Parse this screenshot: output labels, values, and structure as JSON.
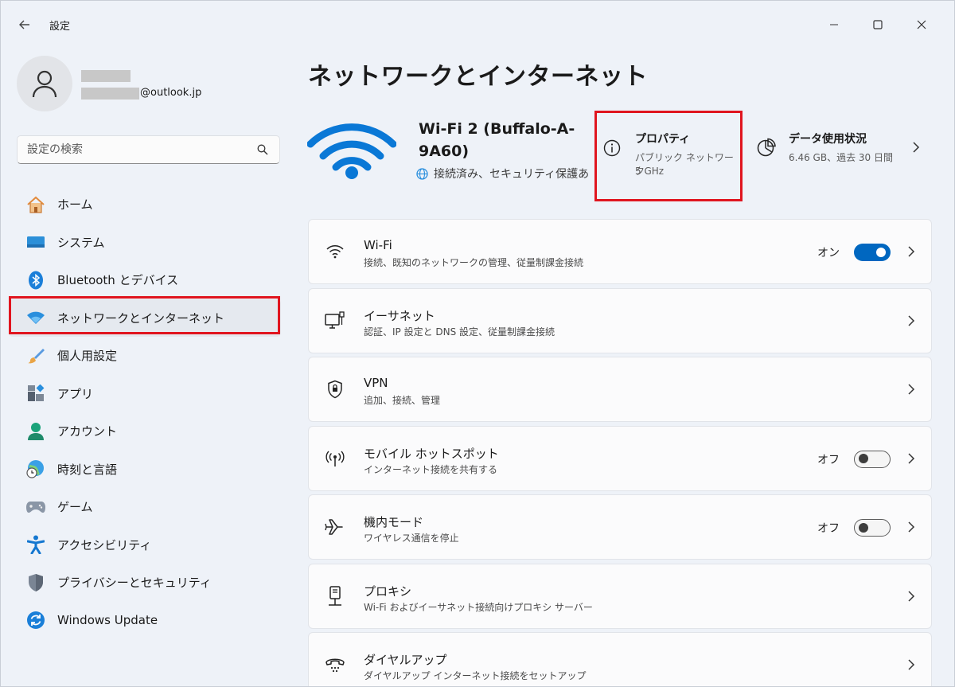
{
  "window": {
    "title": "設定"
  },
  "profile": {
    "email_suffix": "@outlook.jp"
  },
  "search": {
    "placeholder": "設定の検索"
  },
  "sidebar": {
    "items": [
      {
        "label": "ホーム",
        "icon": "home-icon"
      },
      {
        "label": "システム",
        "icon": "system-icon"
      },
      {
        "label": "Bluetooth とデバイス",
        "icon": "bluetooth-icon"
      },
      {
        "label": "ネットワークとインターネット",
        "icon": "wifi-icon",
        "active": true
      },
      {
        "label": "個人用設定",
        "icon": "brush-icon"
      },
      {
        "label": "アプリ",
        "icon": "apps-icon"
      },
      {
        "label": "アカウント",
        "icon": "account-icon"
      },
      {
        "label": "時刻と言語",
        "icon": "clock-globe-icon"
      },
      {
        "label": "ゲーム",
        "icon": "gamepad-icon"
      },
      {
        "label": "アクセシビリティ",
        "icon": "accessibility-icon"
      },
      {
        "label": "プライバシーとセキュリティ",
        "icon": "shield-icon"
      },
      {
        "label": "Windows Update",
        "icon": "update-icon"
      }
    ]
  },
  "main": {
    "title": "ネットワークとインターネット",
    "network": {
      "ssid": "Wi-Fi 2 (Buffalo-A-9A60)",
      "status": "接続済み、セキュリティ保護あ"
    },
    "properties": {
      "title": "プロパティ",
      "line1": "パブリック ネットワーク",
      "line2": "5 GHz"
    },
    "usage": {
      "title": "データ使用状況",
      "sub": "6.46 GB、過去 30 日間"
    },
    "rows": [
      {
        "title": "Wi-Fi",
        "sub": "接続、既知のネットワークの管理、従量制課金接続",
        "state": "オン",
        "toggle": "on",
        "icon": "wifi-icon"
      },
      {
        "title": "イーサネット",
        "sub": "認証、IP 設定と DNS 設定、従量制課金接続",
        "icon": "ethernet-icon"
      },
      {
        "title": "VPN",
        "sub": "追加、接続、管理",
        "icon": "vpn-shield-icon"
      },
      {
        "title": "モバイル ホットスポット",
        "sub": "インターネット接続を共有する",
        "state": "オフ",
        "toggle": "off",
        "icon": "hotspot-icon"
      },
      {
        "title": "機内モード",
        "sub": "ワイヤレス通信を停止",
        "state": "オフ",
        "toggle": "off",
        "icon": "airplane-icon"
      },
      {
        "title": "プロキシ",
        "sub": "Wi-Fi およびイーサネット接続向けプロキシ サーバー",
        "icon": "proxy-icon"
      },
      {
        "title": "ダイヤルアップ",
        "sub": "ダイヤルアップ インターネット接続をセットアップ",
        "icon": "dialup-icon"
      }
    ]
  },
  "colors": {
    "accent": "#0067c0",
    "highlight": "#e0151f"
  }
}
